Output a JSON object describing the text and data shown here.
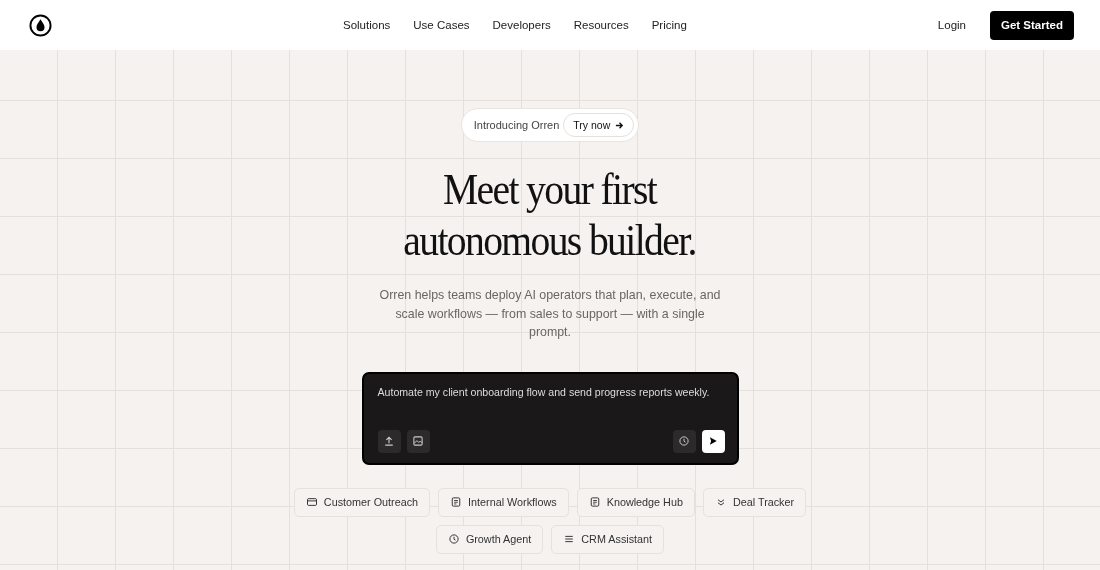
{
  "nav": {
    "links": [
      "Solutions",
      "Use Cases",
      "Developers",
      "Resources",
      "Pricing"
    ],
    "login": "Login",
    "cta": "Get Started"
  },
  "announcement": {
    "text": "Introducing Orren",
    "action": "Try now"
  },
  "hero": {
    "title_lines": [
      "Meet your first",
      "autonomous builder."
    ],
    "subtitle": "Orren helps teams deploy AI operators that plan, execute, and scale workflows — from sales to support — with a single prompt."
  },
  "prompt": {
    "value": "Automate my client onboarding flow and send progress reports weekly."
  },
  "chips": [
    "Customer Outreach",
    "Internal Workflows",
    "Knowledge Hub",
    "Deal Tracker",
    "Growth Agent",
    "CRM Assistant"
  ]
}
